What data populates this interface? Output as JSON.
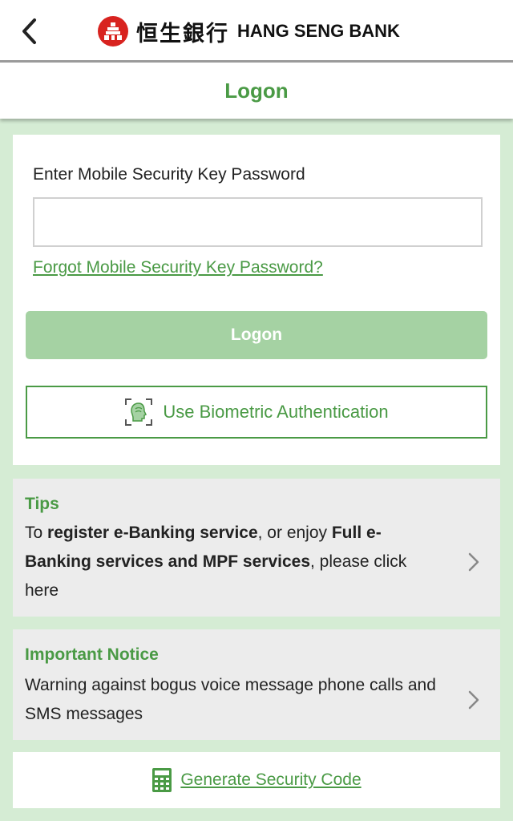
{
  "header": {
    "bank_name_cn": "恒生銀行",
    "bank_name_en": "HANG SENG BANK",
    "page_title": "Logon",
    "icons": {
      "back": "chevron-left-icon",
      "logo": "hang-seng-logo-icon"
    }
  },
  "login": {
    "field_label": "Enter Mobile Security Key Password",
    "password_value": "",
    "forgot_link": "Forgot Mobile Security Key Password?",
    "logon_button": "Logon",
    "biometric_button": "Use Biometric Authentication",
    "icons": {
      "biometric": "face-scan-icon"
    }
  },
  "tips": {
    "title": "Tips",
    "text_1": "To ",
    "bold_1": "register e-Banking service",
    "text_2": ", or enjoy ",
    "bold_2": "Full e-Banking services and MPF services",
    "text_3": ", please click here"
  },
  "notice": {
    "title": "Important Notice",
    "text": "Warning against bogus voice message phone calls and SMS messages"
  },
  "footer": {
    "generate_code": "Generate Security Code",
    "icons": {
      "generate": "calculator-icon"
    }
  },
  "colors": {
    "accent_green": "#4a9a45",
    "button_green_disabled": "#a5d2a3",
    "page_background": "#d5ecd4",
    "logo_red": "#d8231f"
  }
}
